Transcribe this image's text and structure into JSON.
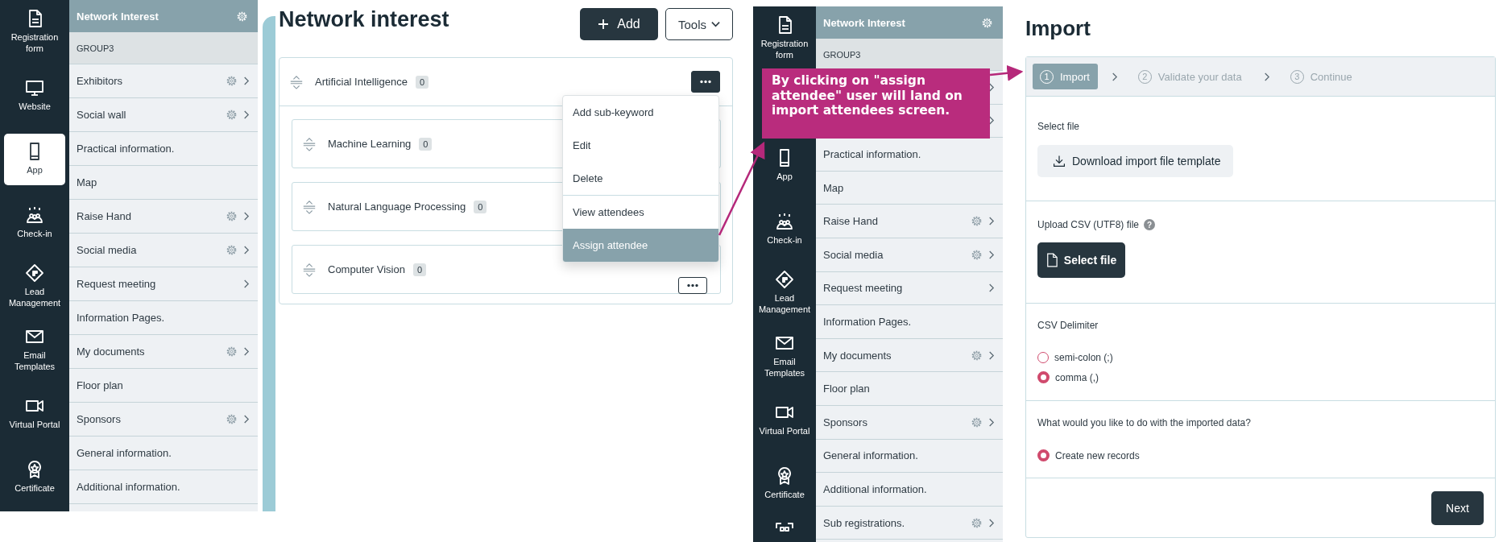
{
  "left_screen": {
    "rail": [
      {
        "label": "Registration form",
        "selected": false
      },
      {
        "label": "Website",
        "selected": false
      },
      {
        "label": "App",
        "selected": true
      },
      {
        "label": "Check-in",
        "selected": false
      },
      {
        "label": "Lead Management",
        "selected": false
      },
      {
        "label": "Email Templates",
        "selected": false
      },
      {
        "label": "Virtual Portal",
        "selected": false
      },
      {
        "label": "Certificate",
        "selected": false
      }
    ],
    "module_list": {
      "title": "Network Interest",
      "group": "GROUP3",
      "items": [
        {
          "label": "Exhibitors",
          "gear": true,
          "chevron": true
        },
        {
          "label": "Social wall",
          "gear": true,
          "chevron": true
        },
        {
          "label": "Practical information.",
          "gear": false,
          "chevron": false
        },
        {
          "label": "Map",
          "gear": false,
          "chevron": false
        },
        {
          "label": "Raise Hand",
          "gear": true,
          "chevron": true
        },
        {
          "label": "Social media",
          "gear": true,
          "chevron": true
        },
        {
          "label": "Request meeting",
          "gear": false,
          "chevron": true
        },
        {
          "label": "Information Pages.",
          "gear": false,
          "chevron": false
        },
        {
          "label": "My documents",
          "gear": true,
          "chevron": true
        },
        {
          "label": "Floor plan",
          "gear": false,
          "chevron": false
        },
        {
          "label": "Sponsors",
          "gear": true,
          "chevron": true
        },
        {
          "label": "General information.",
          "gear": false,
          "chevron": false
        },
        {
          "label": "Additional information.",
          "gear": false,
          "chevron": false
        }
      ]
    },
    "page": {
      "title": "Network interest",
      "add_button": "Add",
      "tools_button": "Tools",
      "keyword": {
        "label": "Artificial Intelligence",
        "count": "0",
        "menu_open": true,
        "children": [
          {
            "label": "Machine Learning",
            "count": "0"
          },
          {
            "label": "Natural Language Processing",
            "count": "0"
          },
          {
            "label": "Computer Vision",
            "count": "0"
          }
        ]
      },
      "menu": {
        "groups": [
          [
            {
              "label": "Add sub-keyword",
              "selected": false
            },
            {
              "label": "Edit",
              "selected": false
            },
            {
              "label": "Delete",
              "selected": false
            }
          ],
          [
            {
              "label": "View attendees",
              "selected": false
            },
            {
              "label": "Assign attendee",
              "selected": true
            }
          ]
        ]
      }
    }
  },
  "right_screen": {
    "rail": [
      {
        "label": "Registration form",
        "selected": false
      },
      {
        "label": "App",
        "selected": false
      },
      {
        "label": "Check-in",
        "selected": false
      },
      {
        "label": "Lead Management",
        "selected": false
      },
      {
        "label": "Email Templates",
        "selected": false
      },
      {
        "label": "Virtual Portal",
        "selected": false
      },
      {
        "label": "Certificate",
        "selected": false
      }
    ],
    "module_list": {
      "title": "Network Interest",
      "group": "GROUP3",
      "items": [
        {
          "gear": false,
          "chevron": true
        },
        {
          "gear": false,
          "chevron": true
        },
        {
          "label": "Practical information.",
          "gear": false,
          "chevron": false
        },
        {
          "label": "Map",
          "gear": false,
          "chevron": false
        },
        {
          "label": "Raise Hand",
          "gear": true,
          "chevron": true
        },
        {
          "label": "Social media",
          "gear": true,
          "chevron": true
        },
        {
          "label": "Request meeting",
          "gear": false,
          "chevron": true
        },
        {
          "label": "Information Pages.",
          "gear": false,
          "chevron": false
        },
        {
          "label": "My documents",
          "gear": true,
          "chevron": true
        },
        {
          "label": "Floor plan",
          "gear": false,
          "chevron": false
        },
        {
          "label": "Sponsors",
          "gear": true,
          "chevron": true
        },
        {
          "label": "General information.",
          "gear": false,
          "chevron": false
        },
        {
          "label": "Additional information.",
          "gear": false,
          "chevron": false
        },
        {
          "label": "Sub registrations.",
          "gear": true,
          "chevron": true
        }
      ]
    },
    "import": {
      "title": "Import",
      "steps": [
        {
          "number": "1",
          "label": "Import",
          "selected": true
        },
        {
          "number": "2",
          "label": "Validate your data",
          "selected": false
        },
        {
          "number": "3",
          "label": "Continue",
          "selected": false
        }
      ],
      "select_file_label": "Select file",
      "download_button": "Download import file template",
      "upload_label": "Upload CSV (UTF8) file",
      "help": "?",
      "select_file_button": "Select file",
      "delimiter_label": "CSV Delimiter",
      "delimiter_options": [
        {
          "label": "semi-colon (;)",
          "selected": false
        },
        {
          "label": "comma (,)",
          "selected": true
        }
      ],
      "question_label": "What would you like to do with the imported data?",
      "question_options": [
        {
          "label": "Create new records",
          "selected": true
        }
      ],
      "next_button": "Next"
    }
  },
  "callout": {
    "text": "By clicking on \"assign attendee\" user will land on import attendees screen."
  }
}
